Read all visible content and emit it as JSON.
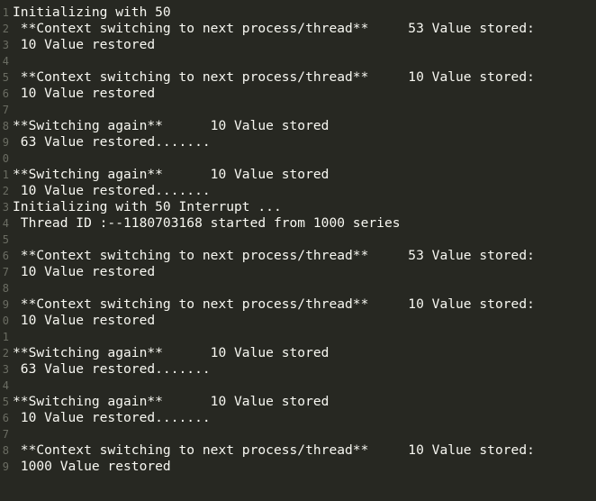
{
  "colors": {
    "background": "#272822",
    "text": "#f8f8f2",
    "line_number": "#6b6d63"
  },
  "lines": [
    {
      "num": "1",
      "text": "Initializing with 50"
    },
    {
      "num": "2",
      "text": " **Context switching to next process/thread**     53 Value stored:"
    },
    {
      "num": "3",
      "text": " 10 Value restored"
    },
    {
      "num": "4",
      "text": ""
    },
    {
      "num": "5",
      "text": " **Context switching to next process/thread**     10 Value stored:"
    },
    {
      "num": "6",
      "text": " 10 Value restored"
    },
    {
      "num": "7",
      "text": ""
    },
    {
      "num": "8",
      "text": "**Switching again**      10 Value stored"
    },
    {
      "num": "9",
      "text": " 63 Value restored......."
    },
    {
      "num": "0",
      "text": ""
    },
    {
      "num": "1",
      "text": "**Switching again**      10 Value stored"
    },
    {
      "num": "2",
      "text": " 10 Value restored......."
    },
    {
      "num": "3",
      "text": "Initializing with 50 Interrupt ..."
    },
    {
      "num": "4",
      "text": " Thread ID :--1180703168 started from 1000 series"
    },
    {
      "num": "5",
      "text": ""
    },
    {
      "num": "6",
      "text": " **Context switching to next process/thread**     53 Value stored:"
    },
    {
      "num": "7",
      "text": " 10 Value restored"
    },
    {
      "num": "8",
      "text": ""
    },
    {
      "num": "9",
      "text": " **Context switching to next process/thread**     10 Value stored:"
    },
    {
      "num": "0",
      "text": " 10 Value restored"
    },
    {
      "num": "1",
      "text": ""
    },
    {
      "num": "2",
      "text": "**Switching again**      10 Value stored"
    },
    {
      "num": "3",
      "text": " 63 Value restored......."
    },
    {
      "num": "4",
      "text": ""
    },
    {
      "num": "5",
      "text": "**Switching again**      10 Value stored"
    },
    {
      "num": "6",
      "text": " 10 Value restored......."
    },
    {
      "num": "7",
      "text": ""
    },
    {
      "num": "8",
      "text": " **Context switching to next process/thread**     10 Value stored:"
    },
    {
      "num": "9",
      "text": " 1000 Value restored"
    }
  ]
}
